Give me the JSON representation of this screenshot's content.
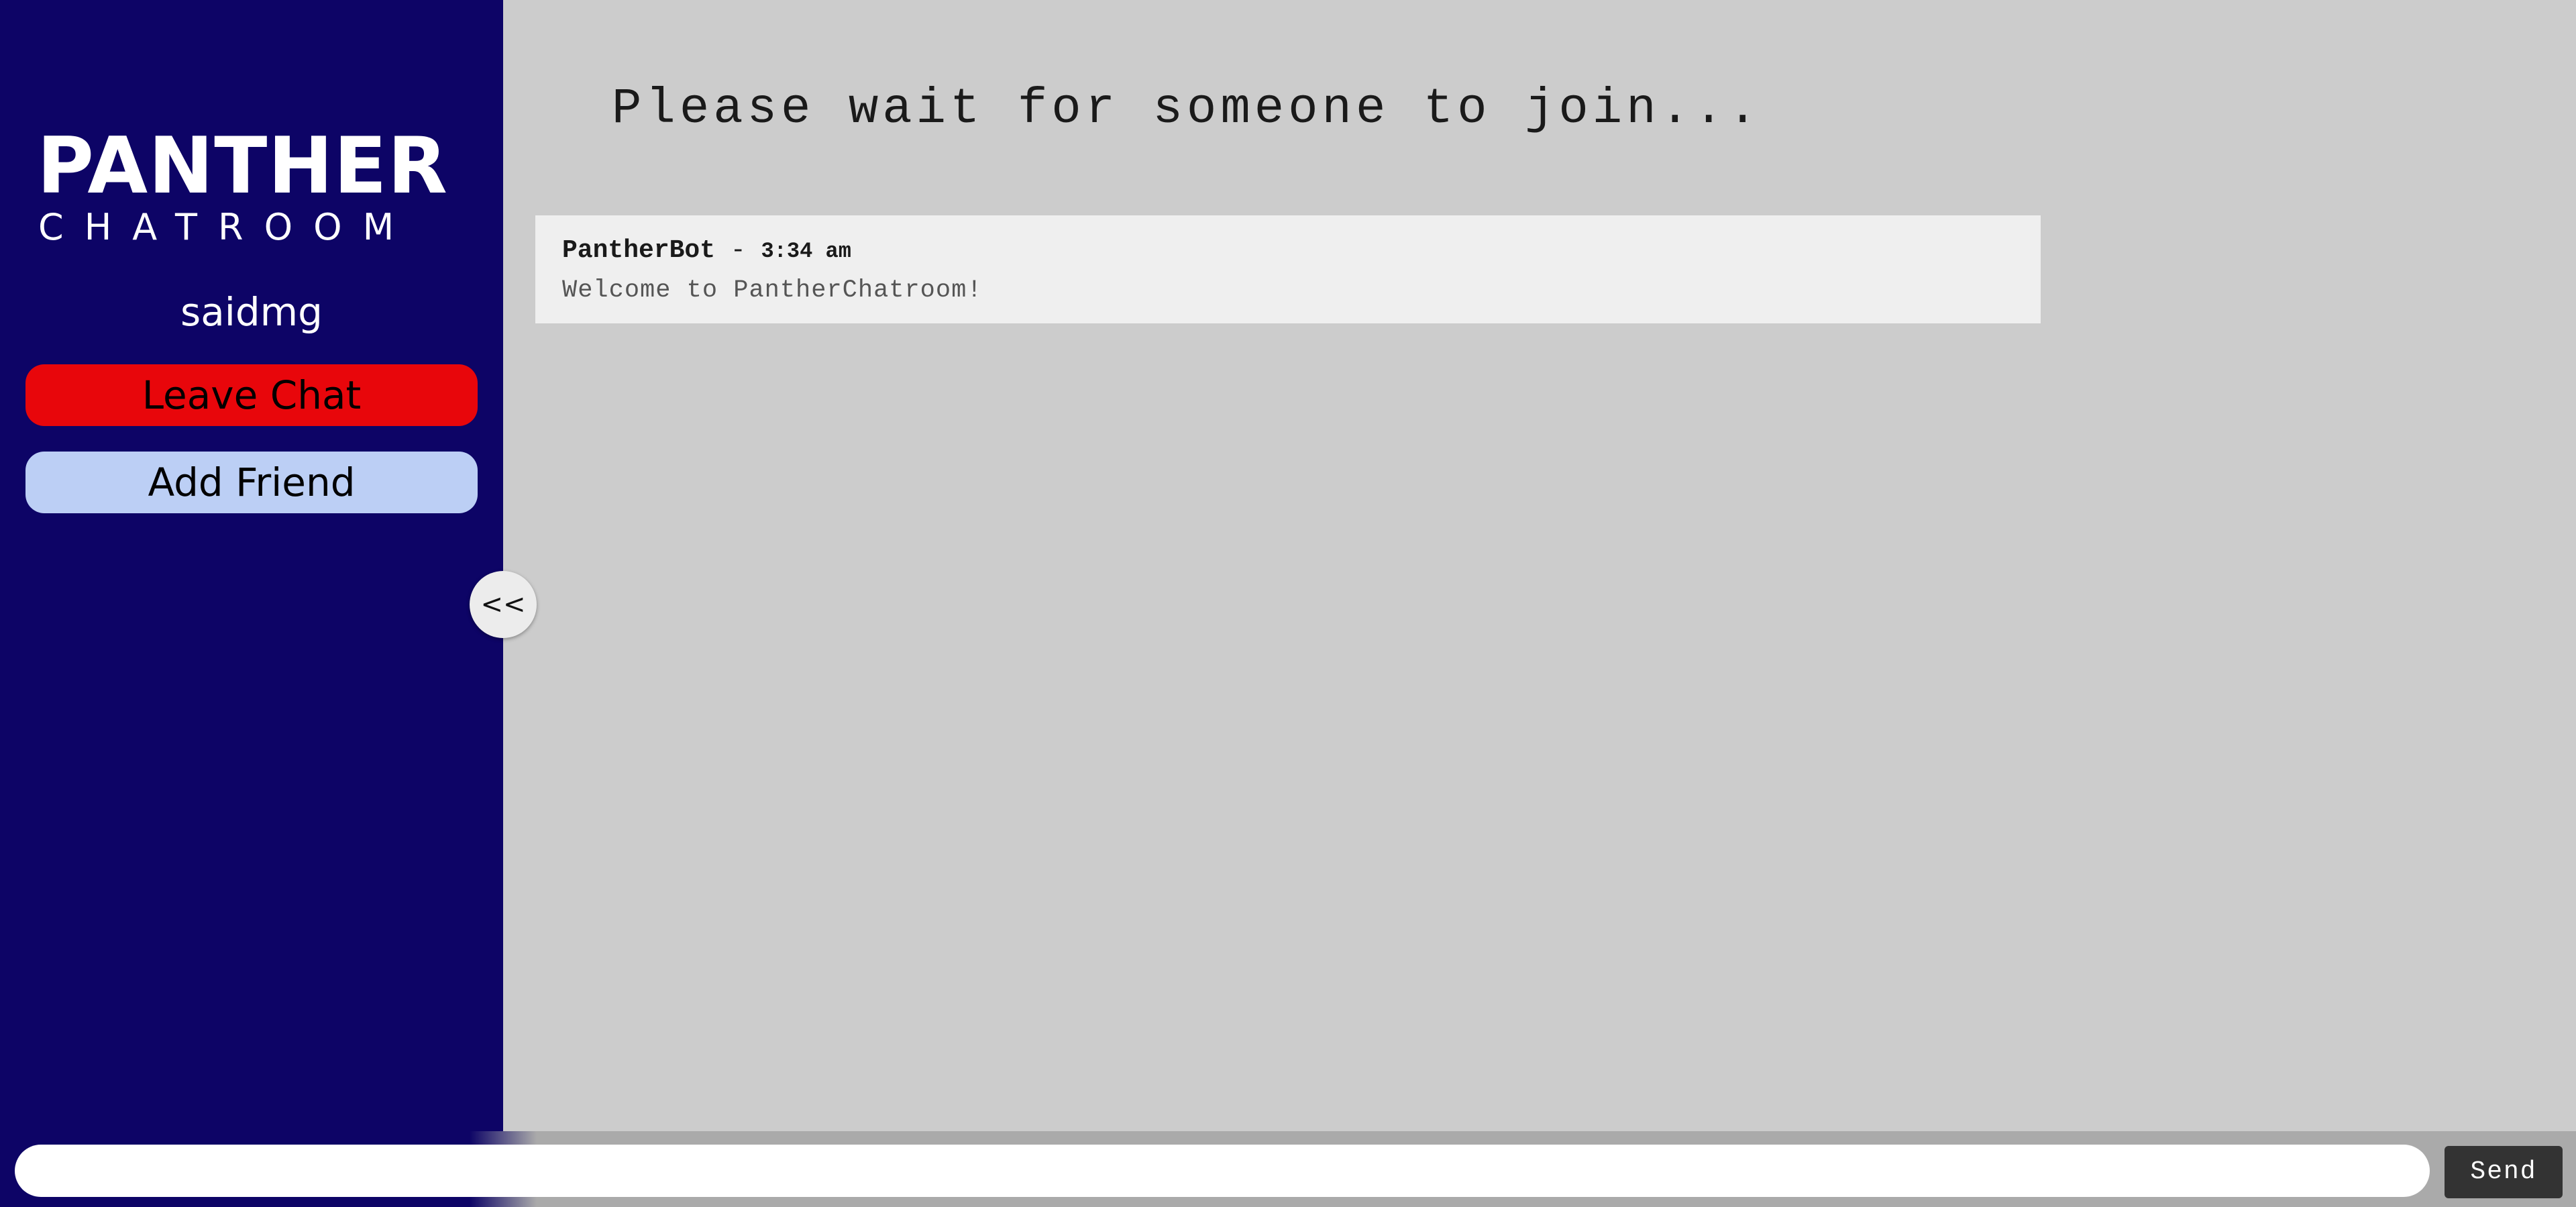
{
  "colors": {
    "sidebar_bg": "#0d0466",
    "main_bg": "#cccccc",
    "leave_button": "#e8060b",
    "add_friend_button": "#bccff5",
    "send_button": "#333333"
  },
  "sidebar": {
    "logo": {
      "line1": "PANTHER",
      "line2": "CHATROOM"
    },
    "username": "saidmg",
    "leave_chat_label": "Leave Chat",
    "add_friend_label": "Add Friend",
    "collapse_label": "<<"
  },
  "main": {
    "status_text": "Please wait for someone to join...",
    "messages": [
      {
        "author": "PantherBot",
        "separator": " - ",
        "time": "3:34 am",
        "text": "Welcome to PantherChatroom!"
      }
    ]
  },
  "composer": {
    "input_value": "",
    "input_placeholder": "",
    "send_label": "Send"
  }
}
